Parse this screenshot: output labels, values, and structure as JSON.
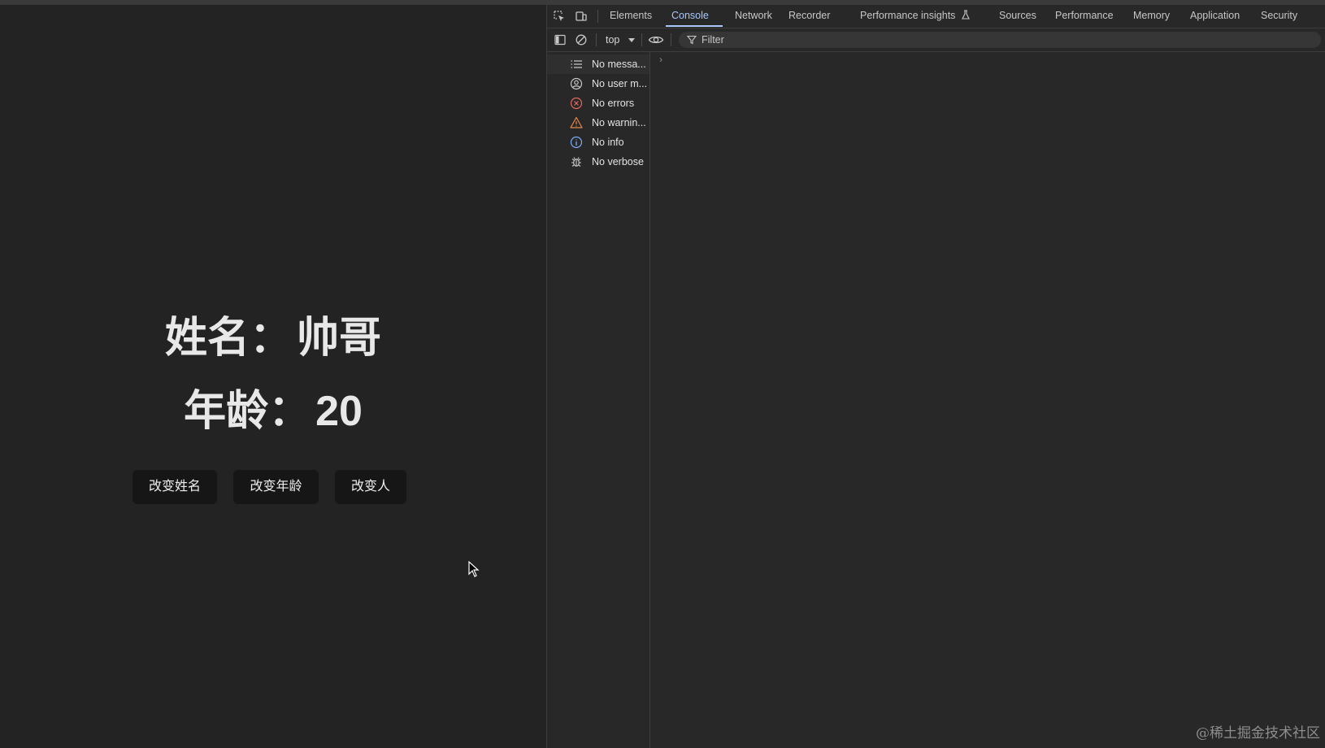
{
  "page": {
    "name_label": "姓名：",
    "name_value": "帅哥",
    "age_label": "年龄：",
    "age_value": "20",
    "buttons": {
      "change_name": "改变姓名",
      "change_age": "改变年龄",
      "change_person": "改变人"
    }
  },
  "devtools": {
    "tabs": [
      "Elements",
      "Console",
      "Network",
      "Recorder",
      "Performance insights",
      "Sources",
      "Performance",
      "Memory",
      "Application",
      "Security"
    ],
    "active_tab": "Console",
    "context": "top",
    "filter_placeholder": "Filter",
    "sidebar": [
      {
        "label": "No messa...",
        "icon": "list-icon"
      },
      {
        "label": "No user m...",
        "icon": "user-icon"
      },
      {
        "label": "No errors",
        "icon": "error-icon"
      },
      {
        "label": "No warnin...",
        "icon": "warning-icon"
      },
      {
        "label": "No info",
        "icon": "info-icon"
      },
      {
        "label": "No verbose",
        "icon": "bug-icon"
      }
    ],
    "prompt": "›"
  },
  "watermark": "@稀土掘金技术社区",
  "colors": {
    "accent": "#a8c7fa",
    "error": "#e46962",
    "warning": "#e8894a",
    "info": "#7cacf8"
  }
}
